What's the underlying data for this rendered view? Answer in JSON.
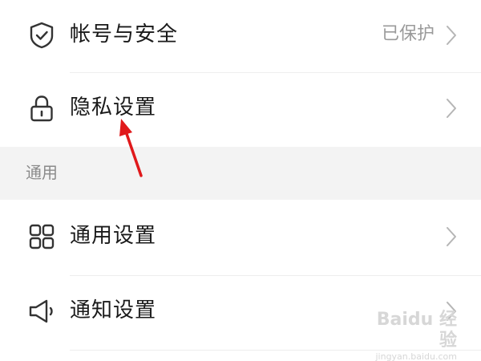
{
  "settings": {
    "rows": [
      {
        "label": "帐号与安全",
        "value": "已保护",
        "icon": "shield-check-icon"
      },
      {
        "label": "隐私设置",
        "value": "",
        "icon": "lock-icon"
      },
      {
        "label": "通用设置",
        "value": "",
        "icon": "grid-icon"
      },
      {
        "label": "通知设置",
        "value": "",
        "icon": "speaker-icon"
      }
    ],
    "section_general": "通用"
  },
  "watermark": {
    "brand": "Baidu 经验",
    "url": "jingyan.baidu.com"
  },
  "colors": {
    "annotation_arrow": "#e0191b",
    "section_bg": "#f3f3f3",
    "secondary_text": "#9a9a9a"
  }
}
